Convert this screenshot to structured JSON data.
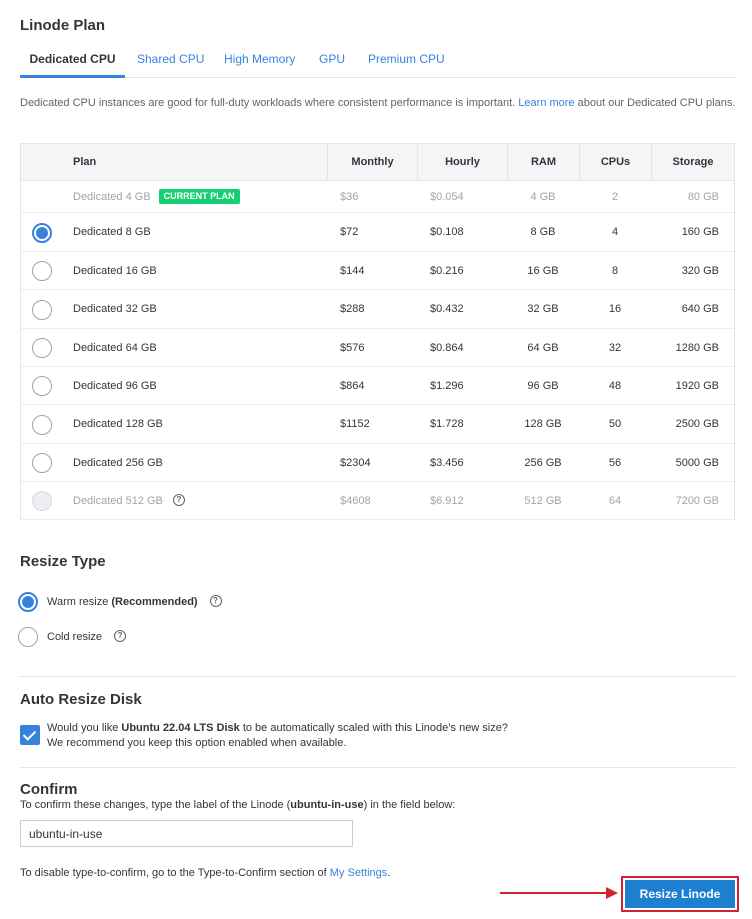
{
  "plan_section": {
    "title": "Linode Plan"
  },
  "tabs": [
    {
      "label": "Dedicated CPU",
      "active": true
    },
    {
      "label": "Shared CPU",
      "active": false
    },
    {
      "label": "High Memory",
      "active": false
    },
    {
      "label": "GPU",
      "active": false
    },
    {
      "label": "Premium CPU",
      "active": false
    }
  ],
  "description": {
    "text_before": "Dedicated CPU instances are good for full-duty workloads where consistent performance is important. ",
    "link": "Learn more",
    "text_after": " about our Dedicated CPU plans."
  },
  "table": {
    "headers": [
      "Plan",
      "Monthly",
      "Hourly",
      "RAM",
      "CPUs",
      "Storage"
    ],
    "current_plan_badge": "CURRENT PLAN",
    "rows": [
      {
        "plan": "Dedicated 4 GB",
        "monthly": "$36",
        "hourly": "$0.054",
        "ram": "4 GB",
        "cpus": "2",
        "storage": "80 GB",
        "state": "current"
      },
      {
        "plan": "Dedicated 8 GB",
        "monthly": "$72",
        "hourly": "$0.108",
        "ram": "8 GB",
        "cpus": "4",
        "storage": "160 GB",
        "state": "selected"
      },
      {
        "plan": "Dedicated 16 GB",
        "monthly": "$144",
        "hourly": "$0.216",
        "ram": "16 GB",
        "cpus": "8",
        "storage": "320 GB",
        "state": "normal"
      },
      {
        "plan": "Dedicated 32 GB",
        "monthly": "$288",
        "hourly": "$0.432",
        "ram": "32 GB",
        "cpus": "16",
        "storage": "640 GB",
        "state": "normal"
      },
      {
        "plan": "Dedicated 64 GB",
        "monthly": "$576",
        "hourly": "$0.864",
        "ram": "64 GB",
        "cpus": "32",
        "storage": "1280 GB",
        "state": "normal"
      },
      {
        "plan": "Dedicated 96 GB",
        "monthly": "$864",
        "hourly": "$1.296",
        "ram": "96 GB",
        "cpus": "48",
        "storage": "1920 GB",
        "state": "normal"
      },
      {
        "plan": "Dedicated 128 GB",
        "monthly": "$1152",
        "hourly": "$1.728",
        "ram": "128 GB",
        "cpus": "50",
        "storage": "2500 GB",
        "state": "normal"
      },
      {
        "plan": "Dedicated 256 GB",
        "monthly": "$2304",
        "hourly": "$3.456",
        "ram": "256 GB",
        "cpus": "56",
        "storage": "5000 GB",
        "state": "normal"
      },
      {
        "plan": "Dedicated 512 GB",
        "monthly": "$4608",
        "hourly": "$6.912",
        "ram": "512 GB",
        "cpus": "64",
        "storage": "7200 GB",
        "state": "disabled"
      }
    ]
  },
  "resize_type": {
    "title": "Resize Type",
    "options": [
      {
        "label": "Warm resize",
        "suffix": "(Recommended)",
        "checked": true
      },
      {
        "label": "Cold resize",
        "suffix": "",
        "checked": false
      }
    ]
  },
  "auto_resize": {
    "title": "Auto Resize Disk",
    "line1_before": "Would you like ",
    "disk_name": "Ubuntu 22.04 LTS Disk",
    "line1_after": " to be automatically scaled with this Linode’s new size?",
    "line2": "We recommend you keep this option enabled when available.",
    "checked": true
  },
  "confirm": {
    "title": "Confirm",
    "instruction_before": "To confirm these changes, type the label of the Linode (",
    "linode_label": "ubuntu-in-use",
    "instruction_after": ") in the field below:",
    "input_value": "ubuntu-in-use",
    "disable_text_before": "To disable type-to-confirm, go to the Type-to-Confirm section of ",
    "disable_link": "My Settings",
    "disable_text_after": "."
  },
  "actions": {
    "resize_label": "Resize Linode"
  },
  "colors": {
    "accent": "#3683dc",
    "badge": "#17cf73",
    "highlight": "#d0252f",
    "button": "#1c7fcf"
  },
  "icons": {
    "help": "help-circle-icon",
    "check": "checkmark-icon",
    "arrow": "arrow-right-icon"
  }
}
